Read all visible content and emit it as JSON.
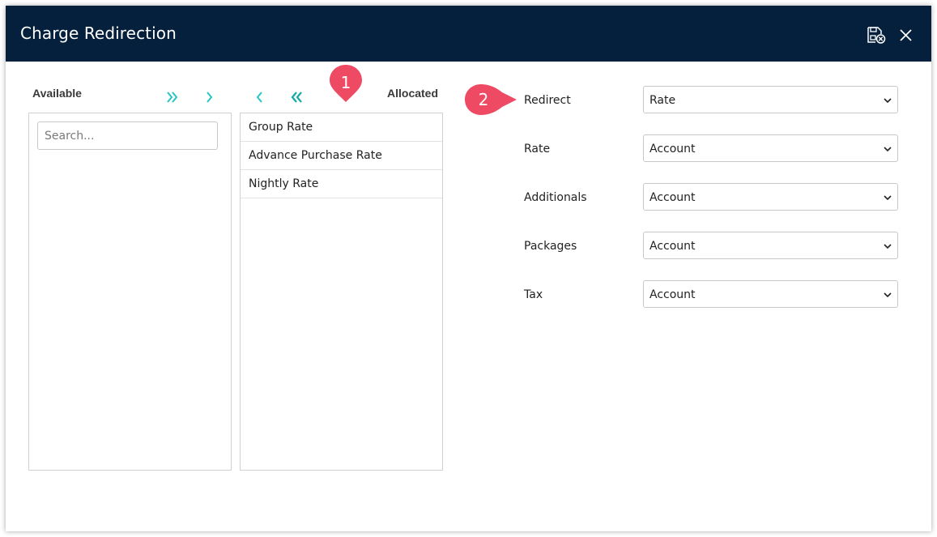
{
  "dialog": {
    "title": "Charge Redirection",
    "save_icon": "save-close-icon",
    "close_icon": "close-icon"
  },
  "available": {
    "label": "Available",
    "search_placeholder": "Search...",
    "move_all_icon": "double-chevron-right-icon",
    "move_one_icon": "chevron-right-icon"
  },
  "allocated": {
    "label": "Allocated",
    "remove_one_icon": "chevron-left-icon",
    "remove_all_icon": "double-chevron-left-icon",
    "items": [
      "Group Rate",
      "Advance Purchase Rate",
      "Nightly Rate"
    ]
  },
  "fields": [
    {
      "label": "Redirect",
      "value": "Rate"
    },
    {
      "label": "Rate",
      "value": "Account"
    },
    {
      "label": "Additionals",
      "value": "Account"
    },
    {
      "label": "Packages",
      "value": "Account"
    },
    {
      "label": "Tax",
      "value": "Account"
    }
  ],
  "callouts": [
    "1",
    "2"
  ],
  "colors": {
    "titlebar": "#04203c",
    "accent_arrows": "#27c4c4",
    "callout": "#ee4a63"
  }
}
